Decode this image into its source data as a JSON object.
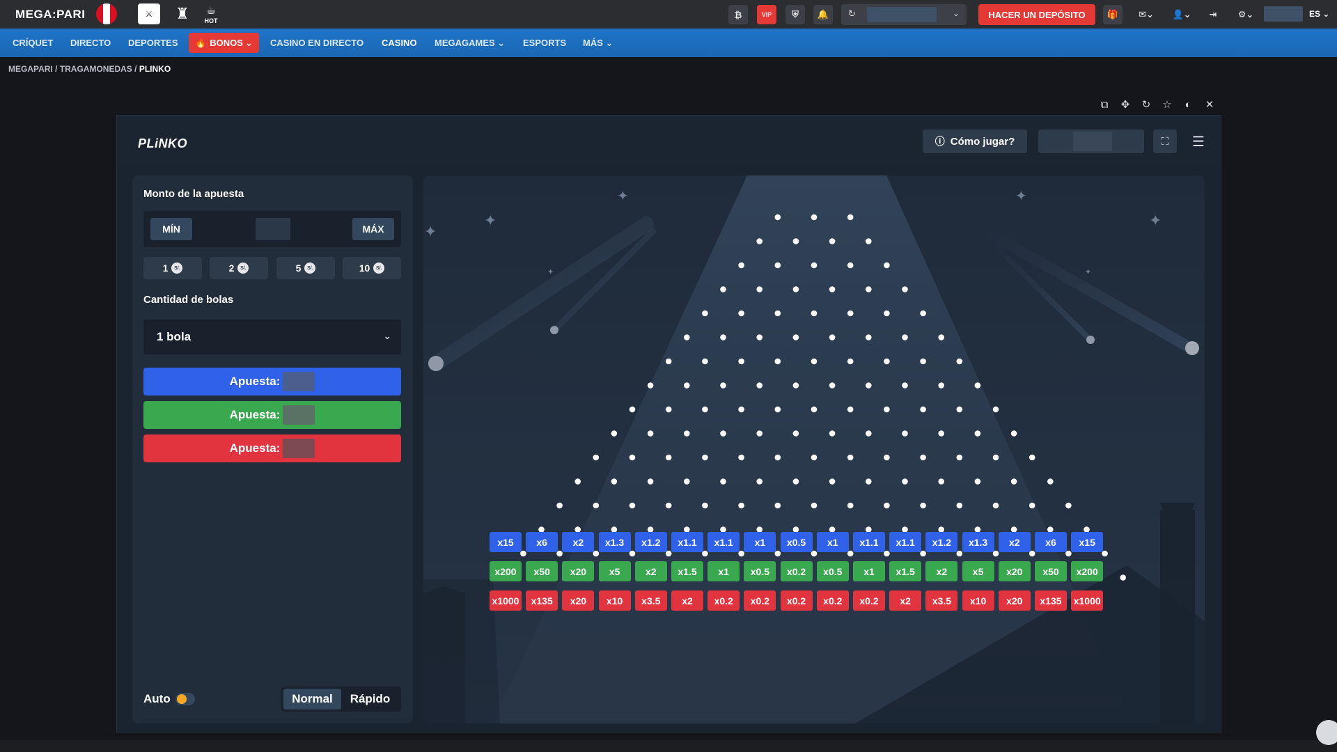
{
  "header": {
    "logo": "MEGA:PARI",
    "vip_label": "VIP",
    "hot_label": "HOT",
    "deposit_label": "HACER UN DEPÓSITO",
    "lang_label": "ES"
  },
  "nav": {
    "items": [
      "CRÍQUET",
      "DIRECTO",
      "DEPORTES",
      "BONOS",
      "CASINO EN DIRECTO",
      "CASINO",
      "MEGAGAMES",
      "ESPORTS",
      "MÁS"
    ]
  },
  "breadcrumb": {
    "parts": [
      "MEGAPARI",
      "TRAGAMONEDAS",
      "PLINKO"
    ]
  },
  "game": {
    "logo": "PLiNKO",
    "howto_label": "Cómo jugar?",
    "bet_title": "Monto de la apuesta",
    "min_label": "MÍN",
    "max_label": "MÁX",
    "chips": [
      "1",
      "2",
      "5",
      "10"
    ],
    "coin_label": "S/.",
    "balls_title": "Cantidad de bolas",
    "balls_value": "1 bola",
    "bet_blue": "Apuesta:",
    "bet_green": "Apuesta:",
    "bet_red": "Apuesta:",
    "auto_label": "Auto",
    "speed_normal": "Normal",
    "speed_fast": "Rápido"
  },
  "multipliers": {
    "blue": [
      "x15",
      "x6",
      "x2",
      "x1.3",
      "x1.2",
      "x1.1",
      "x1.1",
      "x1",
      "x0.5",
      "x1",
      "x1.1",
      "x1.1",
      "x1.2",
      "x1.3",
      "x2",
      "x6",
      "x15"
    ],
    "green": [
      "x200",
      "x50",
      "x20",
      "x5",
      "x2",
      "x1.5",
      "x1",
      "x0.5",
      "x0.2",
      "x0.5",
      "x1",
      "x1.5",
      "x2",
      "x5",
      "x20",
      "x50",
      "x200"
    ],
    "red": [
      "x1000",
      "x135",
      "x20",
      "x10",
      "x3.5",
      "x2",
      "x0.2",
      "x0.2",
      "x0.2",
      "x0.2",
      "x0.2",
      "x2",
      "x3.5",
      "x10",
      "x20",
      "x135",
      "x1000"
    ]
  },
  "colors": {
    "blue": "#2f62e8",
    "green": "#3aa84e",
    "red": "#e2343f",
    "accent": "#e53935"
  }
}
